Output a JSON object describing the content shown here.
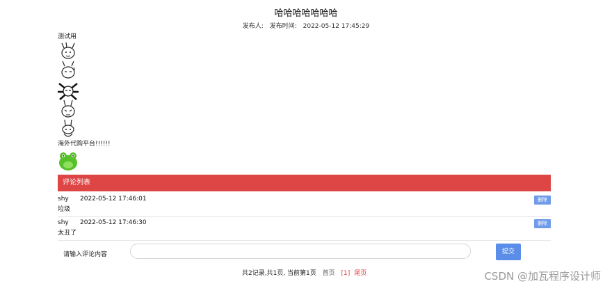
{
  "article": {
    "title": "哈哈哈哈哈哈哈",
    "publisher_label": "发布人:",
    "publish_time_label": "发布时间:",
    "publish_time": "2022-05-12 17:45:29",
    "text1": "测试用",
    "text2": "海外代购平台!!!!!!"
  },
  "emojis": [
    "bunny-fight-icon",
    "bunny-sweat-icon",
    "bunny-shock-icon",
    "bunny-angry-icon",
    "bunny-shy-icon"
  ],
  "comments": {
    "header": "评论列表",
    "items": [
      {
        "user": "shy",
        "time": "2022-05-12 17:46:01",
        "text": "垃圾",
        "delete_label": "删除"
      },
      {
        "user": "shy",
        "time": "2022-05-12 17:46:30",
        "text": "太丑了",
        "delete_label": "删除"
      }
    ]
  },
  "comment_form": {
    "label": "请输入评论内容",
    "input_value": "",
    "submit_label": "提交"
  },
  "pager": {
    "summary": "共2记录,共1页, 当前第1页",
    "first": "首页",
    "current": "[1]",
    "last": "尾页"
  },
  "watermark": "CSDN @加瓦程序设计师",
  "colors": {
    "header_bg": "#de4545",
    "button_bg": "#6f9be8",
    "submit_bg": "#5a8ee8",
    "current_page": "#e23b3b"
  }
}
